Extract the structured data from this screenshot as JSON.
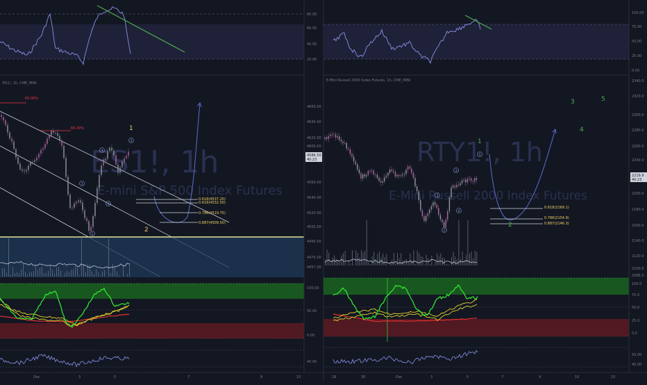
{
  "colors": {
    "background": "#131722",
    "candle": "#9598a1",
    "candle_alt": "#b36aa5",
    "wave_label": "#8fa3e0",
    "fib_line": "#d1d4dc",
    "fib_text": "#f0d264",
    "trend_green": "#4caf50",
    "curve": "#5b6fcf",
    "rsi_line": "#7e86d6",
    "rsi_band": "#2a2a4a",
    "red_level": "#f23645",
    "zone_blue": "#1e3a5a",
    "zone_green": "#1b5e20",
    "zone_red": "#5d1a22",
    "osc_green": "#2ee62e",
    "osc_yellow": "#e6d52e",
    "osc_red": "#e63232",
    "watermark": "#2a3150"
  },
  "left": {
    "header": "ES1!, 1h, CME_MINI",
    "watermark_symbol": "ES1!, 1h",
    "watermark_name": "E-mini S&P 500 Index Futures",
    "price_scale": [
      "4660.00",
      "4640.00",
      "4620.00",
      "4600.00",
      "4560.00",
      "4540.00",
      "4520.00",
      "4505.00",
      "4495.00",
      "4475.00",
      "4457.00"
    ],
    "current_price": "4586.50",
    "current_time": "40:23",
    "rsi_scale": [
      "80.00",
      "60.00",
      "40.00",
      "20.00"
    ],
    "osc_scale": [
      "100.00",
      "50.00",
      "0.00"
    ],
    "mom_scale": [
      "40.00"
    ],
    "pct_labels": [
      "65.00%",
      "65.00%"
    ],
    "fib": [
      "0.618(4537.20)",
      "0.618(4532.50)",
      "0.786(4519.75)",
      "0.887(4509.50)"
    ],
    "wave_major": [
      "1",
      "2"
    ],
    "wave_minor": [
      "1",
      "2",
      "3",
      "4",
      "5"
    ],
    "x_axis": [
      "Dec",
      "3",
      "5",
      "7",
      "9",
      "10"
    ]
  },
  "right": {
    "header": "E-Mini Russell 2000 Index Futures, 1h, CME_MINI",
    "watermark_symbol": "RTY1!, 1h",
    "watermark_name": "E-Mini Russell 2000 Index Futures",
    "price_scale": [
      "2340.0",
      "2320.0",
      "2300.0",
      "2280.0",
      "2260.0",
      "2240.0",
      "2200.0",
      "2180.0",
      "2160.0",
      "2140.0",
      "2120.0",
      "2100.0",
      "2086.5"
    ],
    "current_price": "2219.9",
    "current_time": "40:23",
    "rsi_scale": [
      "100.00",
      "75.00",
      "50.00",
      "25.00",
      "0.00"
    ],
    "osc_scale": [
      "100.0",
      "75.0",
      "50.0",
      "25.0",
      "0.0"
    ],
    "mom_scale": [
      "50.00",
      "45.00"
    ],
    "fib": [
      "0.618(2169.1)",
      "0.786(2154.9)",
      "0.887(2146.3)"
    ],
    "wave_major": [
      "1",
      "2",
      "3",
      "4",
      "5"
    ],
    "wave_minor": [
      "1",
      "2",
      "3",
      "4",
      "5"
    ],
    "x_axis": [
      "29",
      "30",
      "Dec",
      "3",
      "5",
      "7",
      "9",
      "10",
      "15"
    ]
  }
}
